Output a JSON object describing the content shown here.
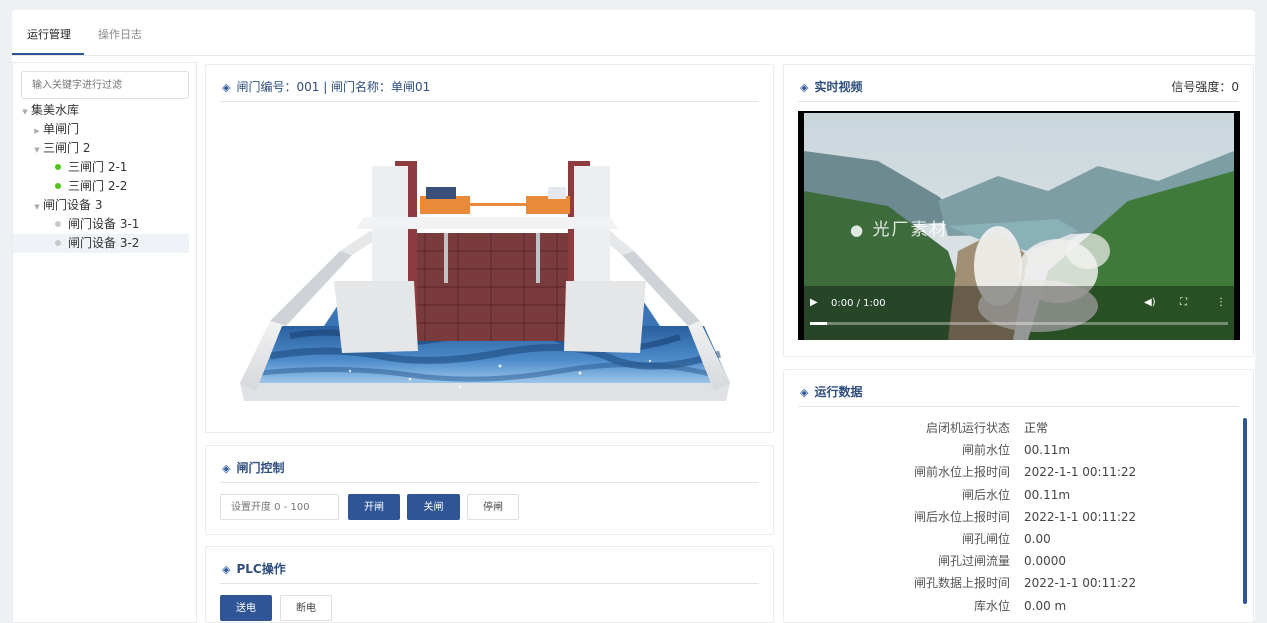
{
  "tabs": [
    {
      "label": "运行管理",
      "active": true
    },
    {
      "label": "操作日志",
      "active": false
    }
  ],
  "tree": {
    "filter_placeholder": "输入关键字进行过滤",
    "nodes": [
      {
        "label": "集美水库",
        "level": 0,
        "expanded": true
      },
      {
        "label": "单闸门",
        "level": 1,
        "expanded": false
      },
      {
        "label": "三闸门 2",
        "level": 1,
        "expanded": true
      },
      {
        "label": "三闸门 2-1",
        "level": 2,
        "status": "online"
      },
      {
        "label": "三闸门 2-2",
        "level": 2,
        "status": "online"
      },
      {
        "label": "闸门设备 3",
        "level": 1,
        "expanded": true
      },
      {
        "label": "闸门设备 3-1",
        "level": 2,
        "status": "offline"
      },
      {
        "label": "闸门设备 3-2",
        "level": 2,
        "status": "offline",
        "selected": true
      }
    ],
    "colors": {
      "online": "#52c41a",
      "offline": "#c8c8c8"
    }
  },
  "gate_view": {
    "title": "闸门编号：001 | 闸门名称：单闸01"
  },
  "gate_control": {
    "title": "闸门控制",
    "opening_placeholder": "设置开度 0 - 100",
    "open_label": "开闸",
    "close_label": "关闸",
    "stop_label": "停闸"
  },
  "plc": {
    "title": "PLC操作",
    "power_on_label": "送电",
    "power_off_label": "断电"
  },
  "video": {
    "title": "实时视频",
    "signal_label": "信号强度：0",
    "watermark": "光厂素材",
    "time": "0:00 / 1:00",
    "progress": 0.04
  },
  "run_data": {
    "title": "运行数据",
    "rows": [
      {
        "label": "启闭机运行状态",
        "value": "正常"
      },
      {
        "label": "闸前水位",
        "value": "00.11m"
      },
      {
        "label": "闸前水位上报时间",
        "value": "2022-1-1 00:11:22"
      },
      {
        "label": "闸后水位",
        "value": "00.11m"
      },
      {
        "label": "闸后水位上报时间",
        "value": "2022-1-1 00:11:22"
      },
      {
        "label": "闸孔闸位",
        "value": "0.00"
      },
      {
        "label": "闸孔过闸流量",
        "value": "0.0000"
      },
      {
        "label": "闸孔数据上报时间",
        "value": "2022-1-1 00:11:22"
      },
      {
        "label": "库水位",
        "value": "0.00 m"
      }
    ]
  },
  "colors": {
    "accent": "#2f5597",
    "title": "#2f4e7f"
  }
}
